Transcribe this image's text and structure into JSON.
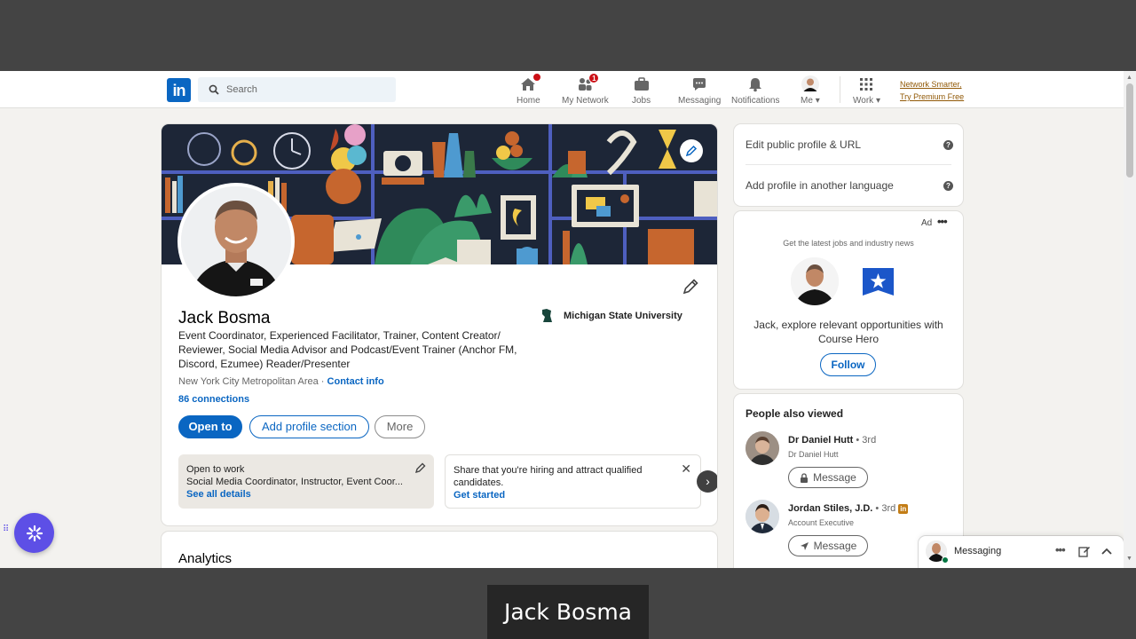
{
  "nav": {
    "logo": "in",
    "search_placeholder": "Search",
    "items": [
      {
        "label": "Home"
      },
      {
        "label": "My Network",
        "badge": "1"
      },
      {
        "label": "Jobs"
      },
      {
        "label": "Messaging"
      },
      {
        "label": "Notifications"
      },
      {
        "label": "Me"
      },
      {
        "label": "Work"
      }
    ],
    "premium_line1": "Network Smarter,",
    "premium_line2": "Try Premium Free"
  },
  "profile": {
    "name": "Jack Bosma",
    "headline": "Event Coordinator, Experienced Facilitator, Trainer, Content Creator/ Reviewer, Social Media Advisor and Podcast/Event Trainer (Anchor FM, Discord, Ezumee) Reader/Presenter",
    "location": "New York City Metropolitan Area",
    "location_sep": " · ",
    "contact_info": "Contact info",
    "connections": "86 connections",
    "school": "Michigan State University",
    "buttons": {
      "open_to": "Open to",
      "add_section": "Add profile section",
      "more": "More"
    },
    "open_to_work": {
      "title": "Open to work",
      "subtitle": "Social Media Coordinator, Instructor, Event Coor...",
      "link": "See all details"
    },
    "hiring": {
      "text_bold": "Share that you're hiring",
      "text_rest": " and attract qualified candidates.",
      "link": "Get started"
    }
  },
  "analytics": {
    "title": "Analytics"
  },
  "sidebar": {
    "edit_public_profile": "Edit public profile & URL",
    "add_language": "Add profile in another language",
    "ad": {
      "label": "Ad",
      "tagline": "Get the latest jobs and industry news",
      "text": "Jack, explore relevant opportunities with Course Hero",
      "follow": "Follow"
    },
    "people_also_viewed": {
      "title": "People also viewed",
      "people": [
        {
          "name": "Dr Daniel Hutt",
          "degree": " • 3rd",
          "subtitle": "Dr Daniel Hutt",
          "button": "Message"
        },
        {
          "name": "Jordan Stiles, J.D.",
          "degree": " • 3rd",
          "subtitle": "Account Executive",
          "button": "Message"
        }
      ]
    }
  },
  "messaging": {
    "label": "Messaging"
  },
  "caption": "Jack Bosma",
  "colors": {
    "brand": "#0a66c2",
    "premium": "#915907",
    "badge": "#cc1016",
    "assistant": "#5d4fe6"
  }
}
